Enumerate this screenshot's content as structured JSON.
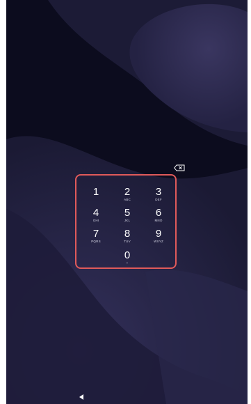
{
  "lockscreen": {
    "keys": [
      {
        "digit": "1",
        "letters": ""
      },
      {
        "digit": "2",
        "letters": "ABC"
      },
      {
        "digit": "3",
        "letters": "DEF"
      },
      {
        "digit": "4",
        "letters": "GHI"
      },
      {
        "digit": "5",
        "letters": "JKL"
      },
      {
        "digit": "6",
        "letters": "MNO"
      },
      {
        "digit": "7",
        "letters": "PQRS"
      },
      {
        "digit": "8",
        "letters": "TUV"
      },
      {
        "digit": "9",
        "letters": "WXYZ"
      },
      {
        "digit": "0",
        "letters": "+"
      }
    ],
    "icons": {
      "backspace": "backspace-icon",
      "nav_back": "nav-back-icon"
    },
    "colors": {
      "background": "#0c0c1e",
      "wave_light": "#2c2a4e",
      "wave_mid": "#221f3e",
      "highlight": "#e05a5a"
    }
  }
}
